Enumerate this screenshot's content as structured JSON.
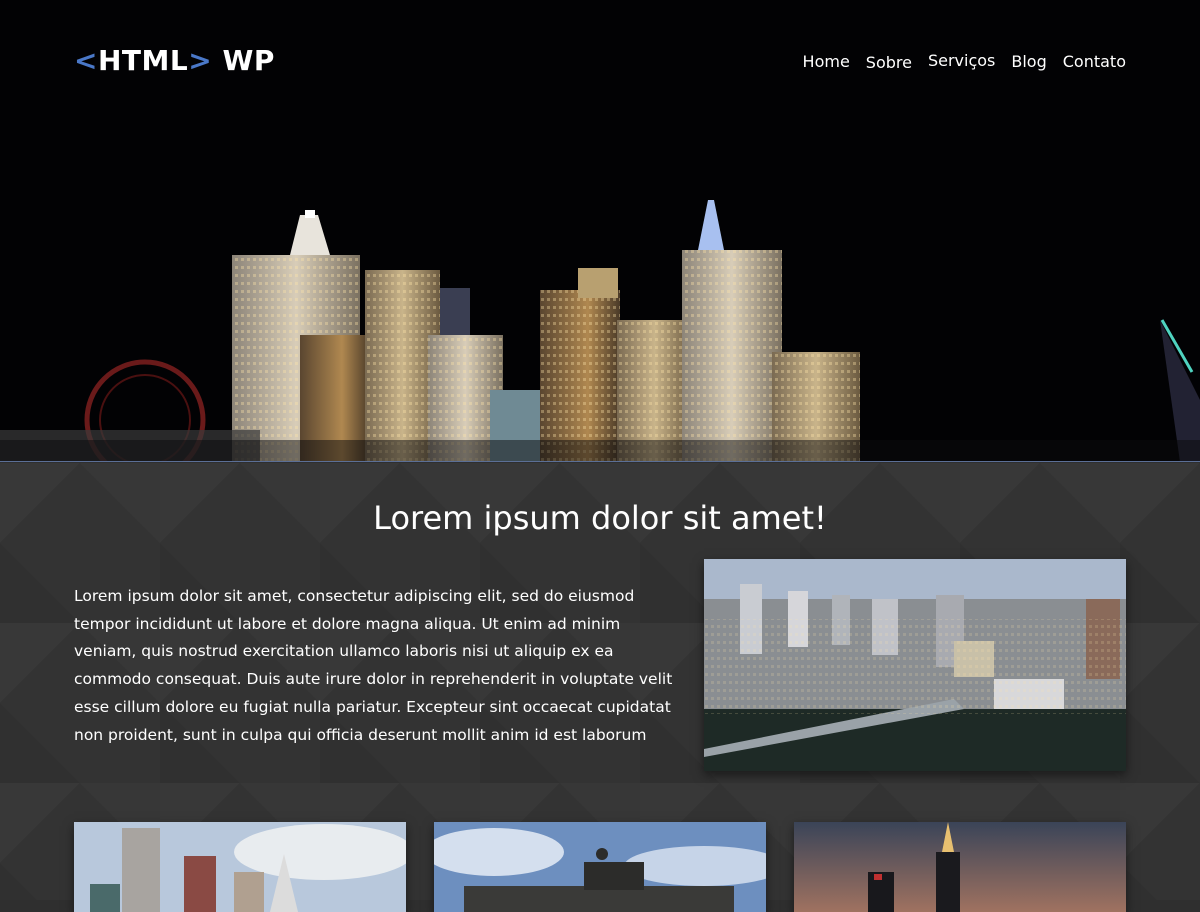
{
  "logo": {
    "open": "<",
    "word": "HTML",
    "close": ">",
    "suffix": "WP"
  },
  "nav": {
    "items": [
      "Home",
      "Sobre",
      "Serviços",
      "Blog",
      "Contato"
    ]
  },
  "hero": {
    "image": "night-city-skyline"
  },
  "section": {
    "title": "Lorem ipsum dolor sit amet!",
    "text": "Lorem ipsum dolor sit amet, consectetur adipiscing elit, sed do eiusmod tempor incididunt ut labore et dolore magna aliqua. Ut enim ad minim veniam, quis nostrud exercitation ullamco laboris nisi ut aliquip ex ea commodo consequat. Duis aute irure dolor in reprehenderit in voluptate velit esse cillum dolore eu fugiat nulla pariatur. Excepteur sint occaecat cupidatat non proident, sunt in culpa qui officia deserunt mollit anim id est laborum",
    "feature_image": "aerial-city-photo"
  },
  "thumbnails": [
    "city-towers-photo",
    "monument-quadriga-photo",
    "dusk-skyline-photo"
  ],
  "colors": {
    "accent": "#4a78c8",
    "hero_border": "#5b6f96",
    "content_bg": "#333333"
  }
}
